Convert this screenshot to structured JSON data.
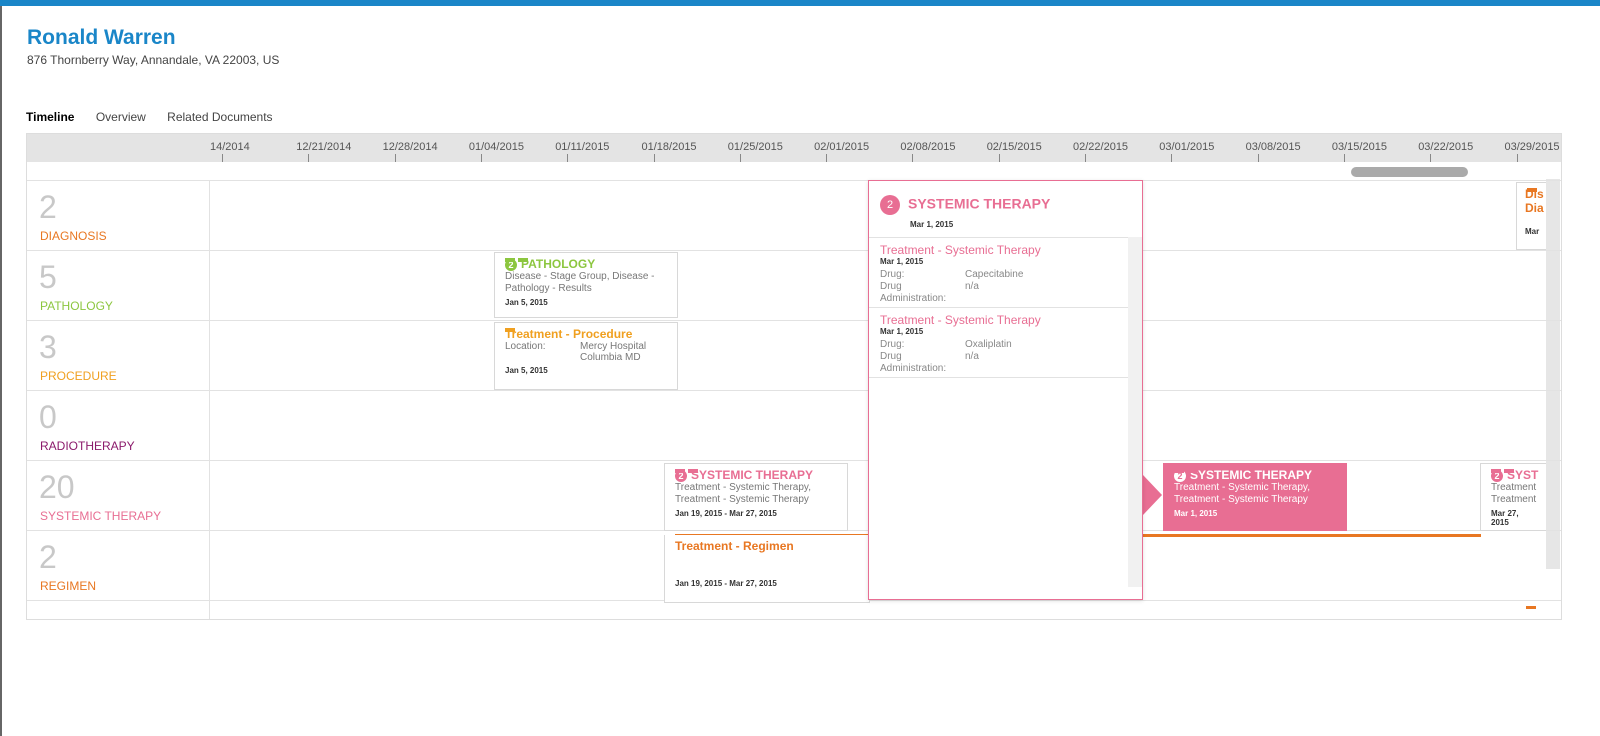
{
  "patient": {
    "name": "Ronald Warren",
    "address": "876 Thornberry Way, Annandale, VA 22003, US"
  },
  "tabs": [
    {
      "label": "Timeline",
      "active": true
    },
    {
      "label": "Overview"
    },
    {
      "label": "Related Documents"
    }
  ],
  "timeline": {
    "dates": [
      "14/2014",
      "12/21/2014",
      "12/28/2014",
      "01/04/2015",
      "01/11/2015",
      "01/18/2015",
      "01/25/2015",
      "02/01/2015",
      "02/08/2015",
      "02/15/2015",
      "02/22/2015",
      "03/01/2015",
      "03/08/2015",
      "03/15/2015",
      "03/22/2015",
      "03/29/2015"
    ],
    "rows": [
      {
        "count": "2",
        "name": "DIAGNOSIS",
        "color": "#e87722"
      },
      {
        "count": "5",
        "name": "PATHOLOGY",
        "color": "#8cc63f"
      },
      {
        "count": "3",
        "name": "PROCEDURE",
        "color": "#f0a020"
      },
      {
        "count": "0",
        "name": "RADIOTHERAPY",
        "color": "#8b1a6b"
      },
      {
        "count": "20",
        "name": "SYSTEMIC THERAPY",
        "color": "#e86e93"
      },
      {
        "count": "2",
        "name": "REGIMEN",
        "color": "#e87722"
      }
    ]
  },
  "cards": {
    "pathology": {
      "badge": "2",
      "title": "PATHOLOGY",
      "sub": "Disease - Stage Group, Disease - Pathology - Results",
      "date": "Jan 5, 2015"
    },
    "procedure": {
      "title": "Treatment - Procedure",
      "location_label": "Location:",
      "location_value": "Mercy Hospital Columbia MD",
      "date": "Jan 5, 2015"
    },
    "systemic1": {
      "badge": "2",
      "title": "SYSTEMIC THERAPY",
      "sub": "Treatment - Systemic Therapy, Treatment - Systemic Therapy",
      "date": "Jan 19, 2015 - Mar 27, 2015"
    },
    "systemic2": {
      "badge": "2",
      "title": "SYSTEMIC THERAPY",
      "sub": "Treatment - Systemic Therapy, Treatment - Systemic Therapy",
      "date": "Mar 1, 2015"
    },
    "systemic3": {
      "badge": "2",
      "title": "SYST",
      "sub1": "Treatment",
      "sub2": "Treatment",
      "date": "Mar 27, 2015"
    },
    "regimen": {
      "title": "Treatment - Regimen",
      "date": "Jan 19, 2015 - Mar 27, 2015"
    },
    "diagnosis_edge": {
      "line1": "Dis",
      "line2": "Dia",
      "date": "Mar"
    }
  },
  "popup": {
    "badge": "2",
    "title": "SYSTEMIC THERAPY",
    "date": "Mar 1, 2015",
    "items": [
      {
        "title": "Treatment - Systemic Therapy",
        "date": "Mar 1, 2015",
        "drug_label": "Drug:",
        "drug_value": "Capecitabine",
        "admin_label": "Drug Administration:",
        "admin_value": "n/a"
      },
      {
        "title": "Treatment - Systemic Therapy",
        "date": "Mar 1, 2015",
        "drug_label": "Drug:",
        "drug_value": "Oxaliplatin",
        "admin_label": "Drug Administration:",
        "admin_value": "n/a"
      }
    ]
  },
  "colors": {
    "accent": "#1a86c8",
    "systemic": "#e86e93",
    "pathology": "#8cc63f",
    "procedure": "#f0a020",
    "regimen": "#e87722"
  }
}
